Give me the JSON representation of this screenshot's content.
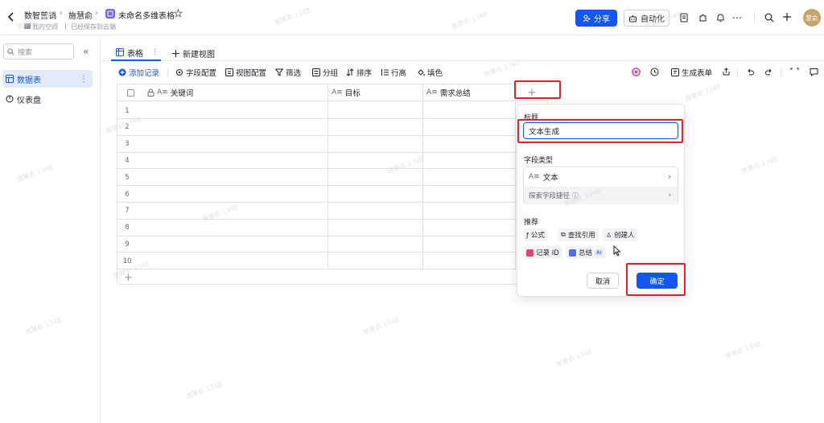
{
  "topbar": {
    "breadcrumb": [
      "数智营销",
      "施慧俞",
      "未命名多维表格"
    ],
    "subtitle_space": "我的空间",
    "subtitle_status": "已经保存到云端",
    "share_label": "分享",
    "automation_label": "自动化",
    "avatar_text": "慧俞",
    "colors": {
      "primary": "#1456f0",
      "app_icon": "#7b61ff"
    }
  },
  "sidebar": {
    "search_placeholder": "搜索",
    "items": [
      {
        "label": "数据表",
        "icon": "table-icon",
        "active": true
      },
      {
        "label": "仪表盘",
        "icon": "dashboard-icon",
        "active": false
      }
    ]
  },
  "tabs": {
    "items": [
      {
        "label": "表格",
        "active": true
      }
    ],
    "new_view_label": "新建视图"
  },
  "toolbar": {
    "add_record": "添加记录",
    "field_config": "字段配置",
    "view_config": "视图配置",
    "filter": "筛选",
    "group": "分组",
    "sort": "排序",
    "row_height": "行高",
    "fill_color": "填色",
    "generate_form": "生成表单"
  },
  "grid": {
    "columns": [
      {
        "name": "关键词",
        "icon": "text-field-icon",
        "locked": true
      },
      {
        "name": "目标",
        "icon": "text-field-icon",
        "locked": false
      },
      {
        "name": "需求总结",
        "icon": "text-field-icon",
        "locked": false
      }
    ],
    "rows": [
      "1",
      "2",
      "3",
      "4",
      "5",
      "6",
      "7",
      "8",
      "9",
      "10"
    ]
  },
  "field_panel": {
    "title_label": "标题",
    "title_value": "文本生成",
    "type_label": "字段类型",
    "type_value": "文本",
    "shortcut_label": "探索字段捷径",
    "recommend_label": "推荐",
    "recommend_items": [
      {
        "label": "公式",
        "icon": "formula-icon"
      },
      {
        "label": "查找引用",
        "icon": "lookup-icon"
      },
      {
        "label": "创建人",
        "icon": "creator-icon"
      },
      {
        "label": "记录 ID",
        "icon": "record-id-icon"
      },
      {
        "label": "总结",
        "icon": "summary-icon",
        "badge": "AI"
      }
    ],
    "cancel_label": "取消",
    "confirm_label": "确定"
  },
  "watermark": "施慧俞 1348"
}
